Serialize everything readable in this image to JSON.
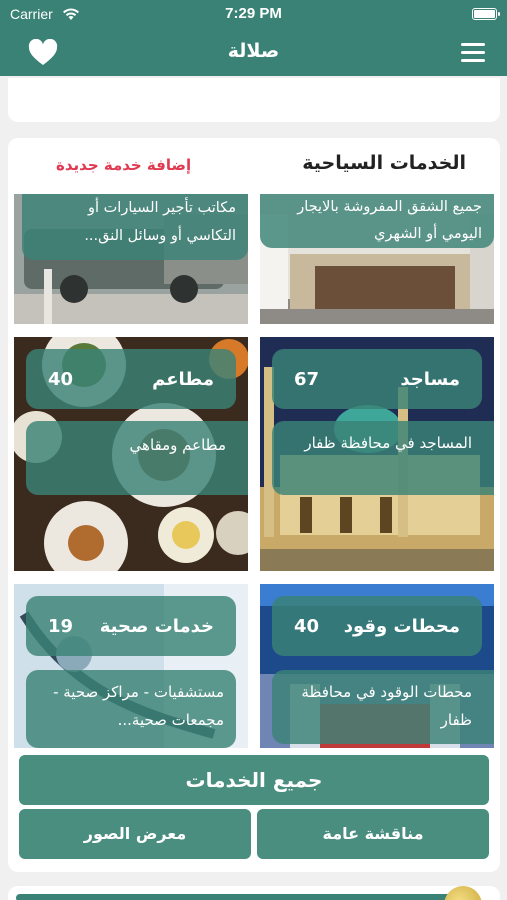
{
  "status_bar": {
    "carrier": "Carrier",
    "time": "7:29 PM"
  },
  "nav": {
    "title": "صلالة",
    "left_icon": "heart-icon",
    "right_icon": "menu-icon"
  },
  "section": {
    "title": "الخدمات السياحية",
    "add_link": "إضافة خدمة جديدة"
  },
  "tiles": [
    {
      "id": "apartments",
      "description": "جميع الشقق المفروشة بالايجار اليومي أو الشهري"
    },
    {
      "id": "car-rental",
      "description": "مكاتب تأجير السيارات أو التكاسي أو وسائل النق..."
    },
    {
      "id": "mosques",
      "title": "مساجد",
      "count": "67",
      "description": "المساجد في محافظة ظفار"
    },
    {
      "id": "restaurants",
      "title": "مطاعم",
      "count": "40",
      "description": "مطاعم ومقاهي"
    },
    {
      "id": "fuel",
      "title": "محطات وقود",
      "count": "40",
      "description": "محطات الوقود في محافظة ظفار"
    },
    {
      "id": "health",
      "title": "خدمات صحية",
      "count": "19",
      "description": "مستشفيات - مراكز صحية - مجمعات صحية..."
    }
  ],
  "buttons": {
    "all_services": "جميع الخدمات",
    "discussion": "مناقشة عامة",
    "gallery": "معرض الصور"
  },
  "colors": {
    "primary": "#3a8276",
    "accent": "#e03a52",
    "button": "#4a8e80"
  }
}
